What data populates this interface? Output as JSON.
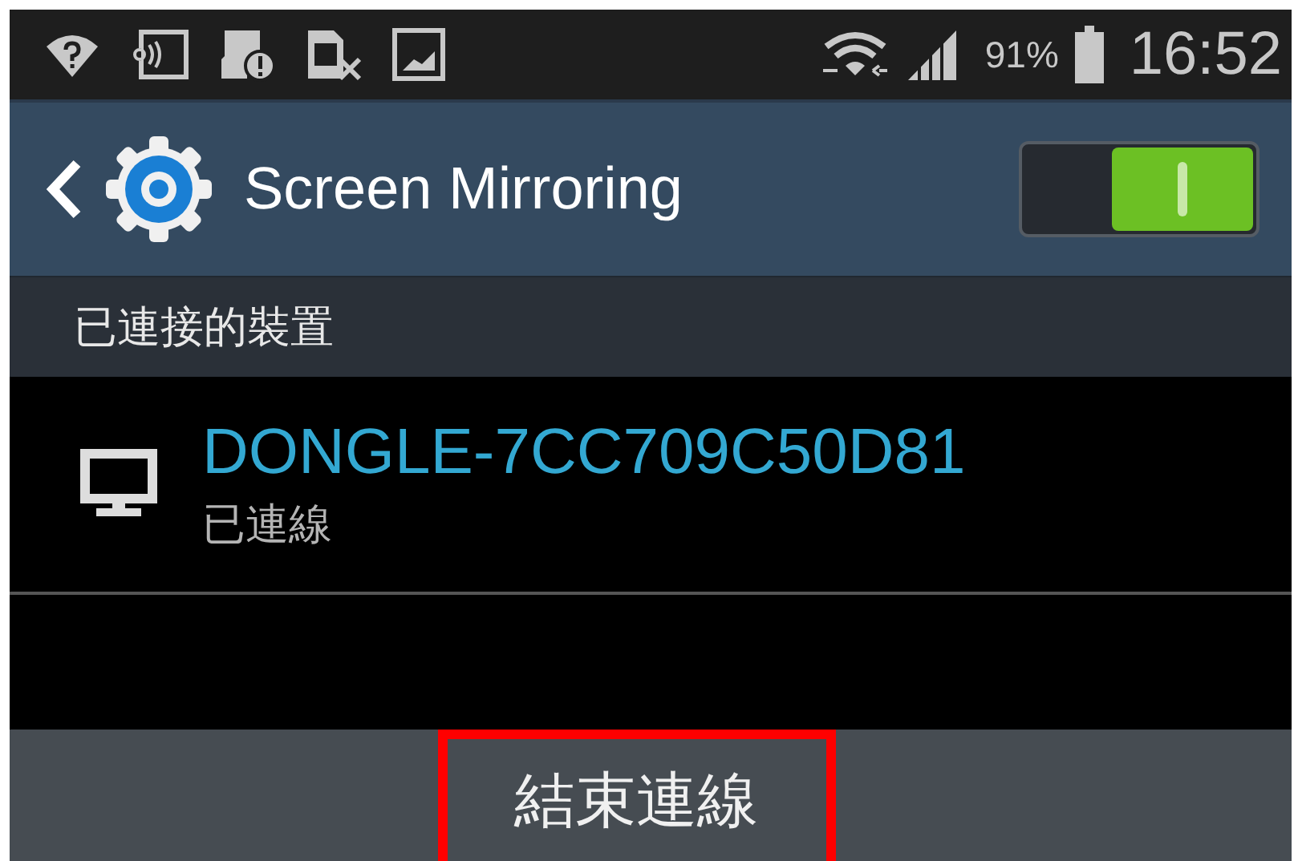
{
  "status_bar": {
    "battery": "91%",
    "time": "16:52"
  },
  "action_bar": {
    "title": "Screen Mirroring",
    "switch": {
      "on": true
    }
  },
  "section_header": "已連接的裝置",
  "devices": [
    {
      "name": "DONGLE-7CC709C50D81",
      "status": "已連線"
    }
  ],
  "bottom_button": {
    "label": "結束連線",
    "highlighted": true
  }
}
